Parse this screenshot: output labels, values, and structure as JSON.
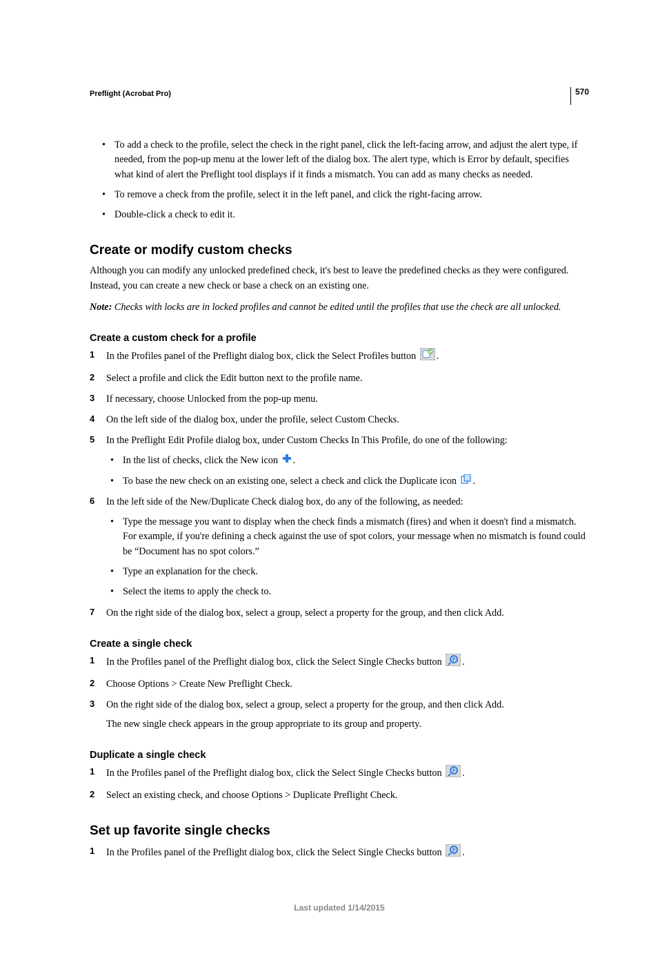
{
  "page_number": "570",
  "running_head": "Preflight (Acrobat Pro)",
  "top_bullets": [
    "To add a check to the profile, select the check in the right panel, click the left-facing arrow, and adjust the alert type, if needed, from the pop-up menu at the lower left of the dialog box. The alert type, which is Error by default, specifies what kind of alert the Preflight tool displays if it finds a mismatch. You can add as many checks as needed.",
    "To remove a check from the profile, select it in the left panel, and click the right-facing arrow.",
    "Double-click a check to edit it."
  ],
  "section1": {
    "title": "Create or modify custom checks",
    "intro": "Although you can modify any unlocked predefined check, it's best to leave the predefined checks as they were configured. Instead, you can create a new check or base a check on an existing one.",
    "note_lead": "Note:",
    "note_body": " Checks with locks are in locked profiles and cannot be edited until the profiles that use the check are all unlocked."
  },
  "sub_profile": {
    "title": "Create a custom check for a profile",
    "steps": {
      "s1_a": "In the Profiles panel of the Preflight dialog box, click the Select Profiles button ",
      "s1_b": ".",
      "s2": "Select a profile and click the Edit button next to the profile name.",
      "s3": "If necessary, choose Unlocked from the pop-up menu.",
      "s4": "On the left side of the dialog box, under the profile, select Custom Checks.",
      "s5_intro": "In the Preflight Edit Profile dialog box, under Custom Checks In This Profile, do one of the following:",
      "s5_b1_a": "In the list of checks, click the New icon ",
      "s5_b1_b": ".",
      "s5_b2_a": "To base the new check on an existing one, select a check and click the Duplicate icon ",
      "s5_b2_b": ".",
      "s6_intro": "In the left side of the New/Duplicate Check dialog box, do any of the following, as needed:",
      "s6_b1": "Type the message you want to display when the check finds a mismatch (fires) and when it doesn't find a mismatch. For example, if you're defining a check against the use of spot colors, your message when no mismatch is found could be “Document has no spot colors.”",
      "s6_b2": "Type an explanation for the check.",
      "s6_b3": "Select the items to apply the check to.",
      "s7": "On the right side of the dialog box, select a group, select a property for the group, and then click Add."
    }
  },
  "sub_single": {
    "title": "Create a single check",
    "steps": {
      "s1_a": "In the Profiles panel of the Preflight dialog box, click the Select Single Checks button ",
      "s1_b": ".",
      "s2": "Choose Options > Create New Preflight Check.",
      "s3": "On the right side of the dialog box, select a group, select a property for the group, and then click Add.",
      "s3_sub": "The new single check appears in the group appropriate to its group and property."
    }
  },
  "sub_dup": {
    "title": "Duplicate a single check",
    "steps": {
      "s1_a": "In the Profiles panel of the Preflight dialog box, click the Select Single Checks button ",
      "s1_b": ".",
      "s2": "Select an existing check, and choose Options > Duplicate Preflight Check."
    }
  },
  "section2": {
    "title": "Set up favorite single checks",
    "steps": {
      "s1_a": "In the Profiles panel of the Preflight dialog box, click the Select Single Checks button ",
      "s1_b": "."
    }
  },
  "footer": "Last updated 1/14/2015"
}
